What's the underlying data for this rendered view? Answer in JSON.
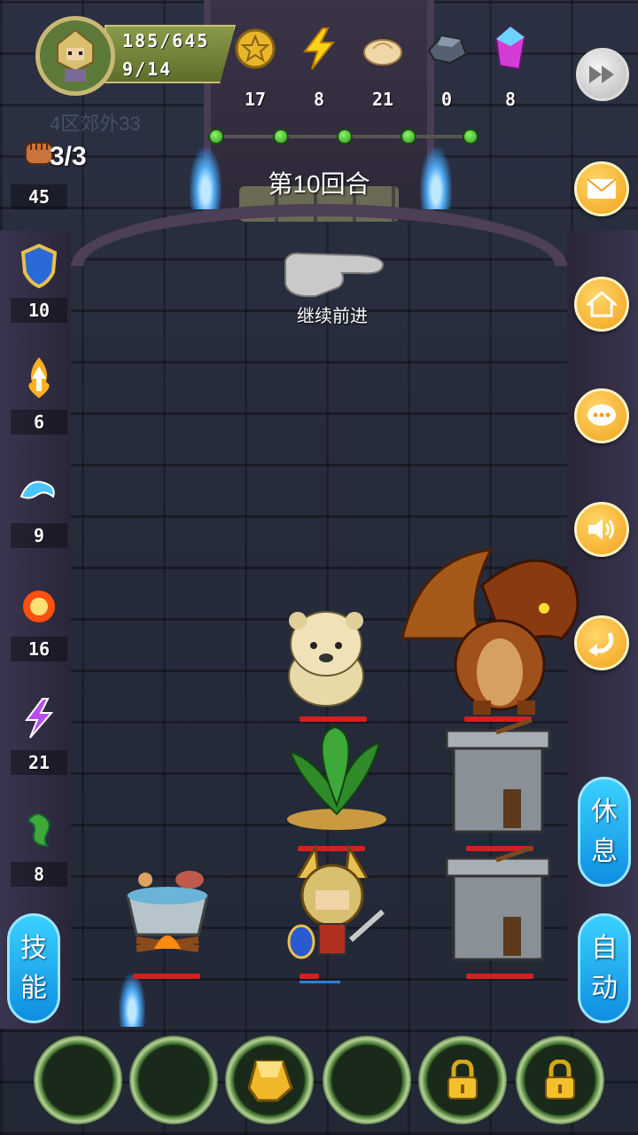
{
  "player": {
    "hp": "185/645",
    "level": "9/14"
  },
  "resources": [
    {
      "name": "gold-coin-icon",
      "value": "17"
    },
    {
      "name": "lightning-icon",
      "value": "8"
    },
    {
      "name": "bun-icon",
      "value": "21"
    },
    {
      "name": "iron-ore-icon",
      "value": "0"
    },
    {
      "name": "crystal-icon",
      "value": "8"
    }
  ],
  "zone": "4区郊外33",
  "round": "第10回合",
  "progress": {
    "total_stages": 5,
    "completed": 5
  },
  "continue_label": "继续前进",
  "fist_count": "3/3",
  "stats": [
    {
      "icon": "fist-icon",
      "value": "45"
    },
    {
      "icon": "shield-icon",
      "value": "10"
    },
    {
      "icon": "fire-arrow-icon",
      "value": "6"
    },
    {
      "icon": "water-icon",
      "value": "9"
    },
    {
      "icon": "fireball-icon",
      "value": "16"
    },
    {
      "icon": "lightning-purple-icon",
      "value": "21"
    },
    {
      "icon": "poison-icon",
      "value": "8"
    }
  ],
  "buttons": {
    "skill": [
      "技",
      "能"
    ],
    "rest": [
      "休",
      "息"
    ],
    "auto": [
      "自",
      "动"
    ]
  },
  "colors": {
    "accent_orange": "#f2a21a",
    "accent_blue": "#0e8ee0",
    "hp_red": "#d42020"
  },
  "bottom_slots": [
    "empty",
    "empty",
    "gold-ingot",
    "empty",
    "locked",
    "locked"
  ]
}
